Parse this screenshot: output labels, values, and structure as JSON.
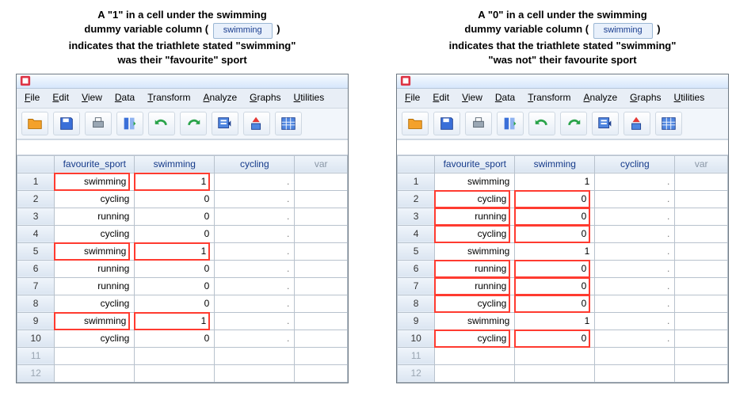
{
  "chip_label": "swimming",
  "captions": {
    "left": [
      "A \"1\" in a cell under the swimming",
      "dummy variable column (",
      "indicates that the triathlete stated \"swimming\"",
      "was their \"favourite\" sport"
    ],
    "right": [
      "A \"0\" in a cell under the swimming",
      "dummy variable column (",
      "indicates that the triathlete stated \"swimming\"",
      "\"was not\" their favourite sport"
    ]
  },
  "menu": [
    "File",
    "Edit",
    "View",
    "Data",
    "Transform",
    "Analyze",
    "Graphs",
    "Utilities"
  ],
  "columns": [
    "favourite_sport",
    "swimming",
    "cycling",
    "var"
  ],
  "rows": [
    {
      "n": 1,
      "fs": "swimming",
      "sw": 1,
      "cy": "."
    },
    {
      "n": 2,
      "fs": "cycling",
      "sw": 0,
      "cy": "."
    },
    {
      "n": 3,
      "fs": "running",
      "sw": 0,
      "cy": "."
    },
    {
      "n": 4,
      "fs": "cycling",
      "sw": 0,
      "cy": "."
    },
    {
      "n": 5,
      "fs": "swimming",
      "sw": 1,
      "cy": "."
    },
    {
      "n": 6,
      "fs": "running",
      "sw": 0,
      "cy": "."
    },
    {
      "n": 7,
      "fs": "running",
      "sw": 0,
      "cy": "."
    },
    {
      "n": 8,
      "fs": "cycling",
      "sw": 0,
      "cy": "."
    },
    {
      "n": 9,
      "fs": "swimming",
      "sw": 1,
      "cy": "."
    },
    {
      "n": 10,
      "fs": "cycling",
      "sw": 0,
      "cy": "."
    }
  ],
  "empty_rows": [
    11,
    12
  ],
  "highlight_value": {
    "left": 1,
    "right": 0
  },
  "toolbar_icons": [
    "open",
    "save",
    "print",
    "columns",
    "undo",
    "redo",
    "import",
    "sort",
    "table"
  ]
}
